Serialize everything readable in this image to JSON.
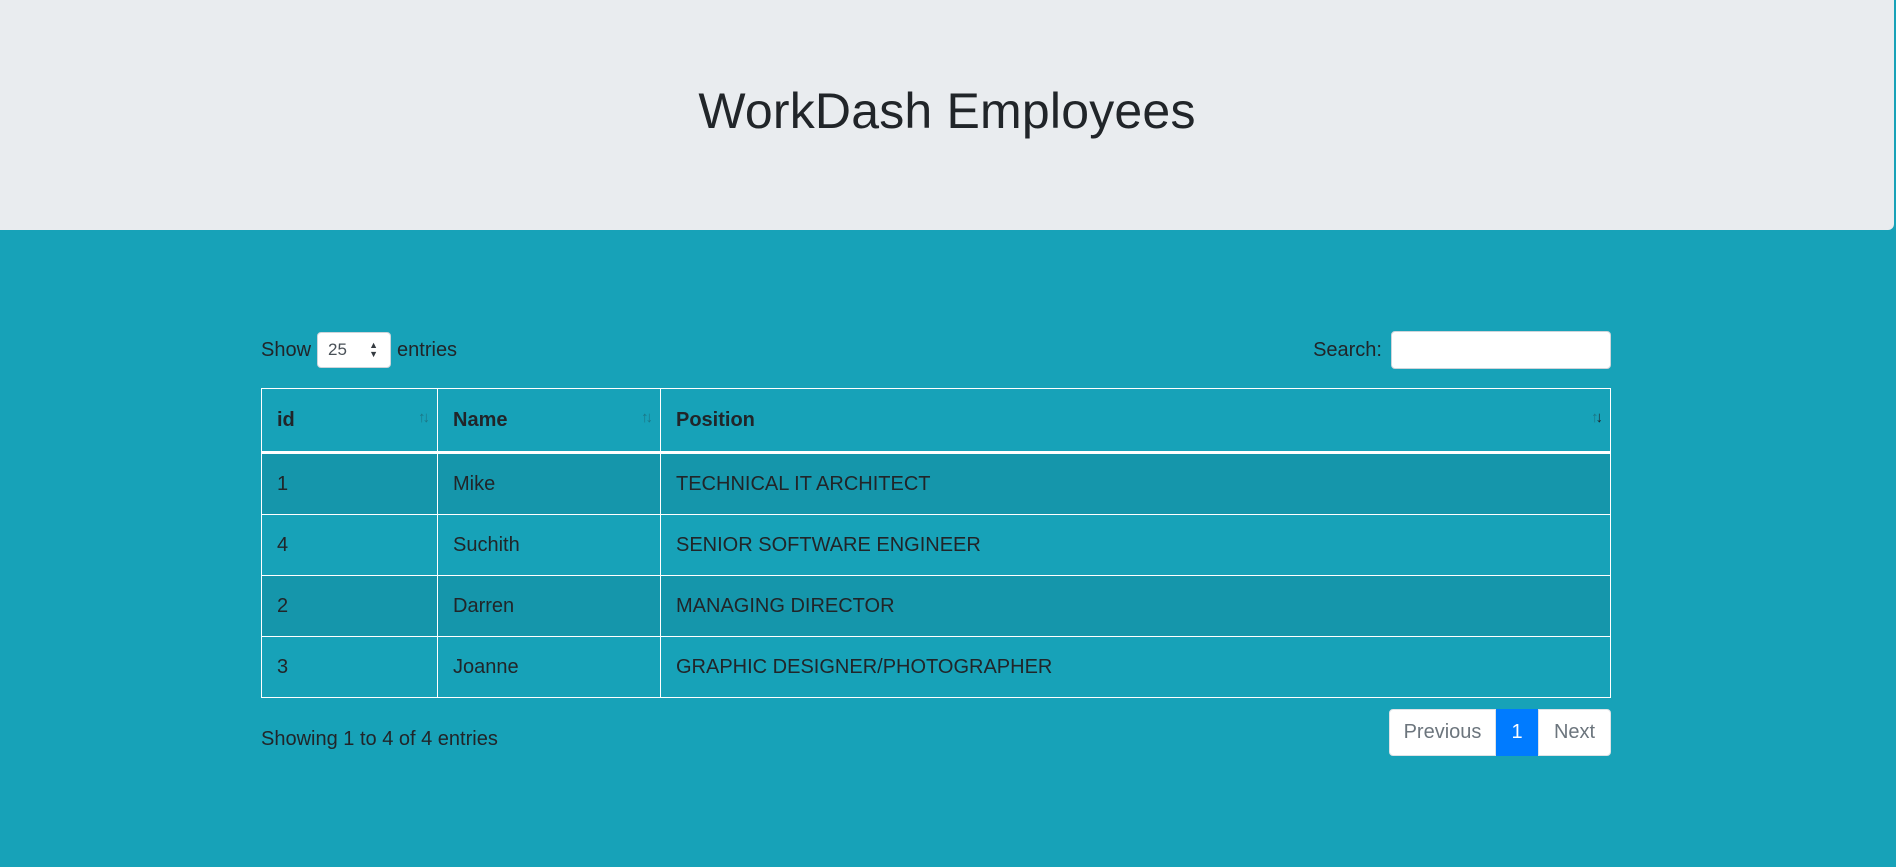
{
  "header": {
    "title": "WorkDash Employees"
  },
  "length": {
    "show_label": "Show",
    "value": "25",
    "entries_label": "entries"
  },
  "search": {
    "label": "Search:",
    "value": "",
    "placeholder": ""
  },
  "table": {
    "columns": [
      "id",
      "Name",
      "Position"
    ],
    "sort": {
      "column": "Position",
      "direction": "desc"
    },
    "rows": [
      [
        "1",
        "Mike",
        "TECHNICAL IT ARCHITECT"
      ],
      [
        "4",
        "Suchith",
        "SENIOR SOFTWARE ENGINEER"
      ],
      [
        "2",
        "Darren",
        "MANAGING DIRECTOR"
      ],
      [
        "3",
        "Joanne",
        "GRAPHIC DESIGNER/PHOTOGRAPHER"
      ]
    ]
  },
  "info": "Showing 1 to 4 of 4 entries",
  "pagination": {
    "previous": "Previous",
    "current": "1",
    "next": "Next"
  },
  "colors": {
    "background": "#17a2b8",
    "header": "#e9ecef",
    "accent": "#007bff"
  }
}
